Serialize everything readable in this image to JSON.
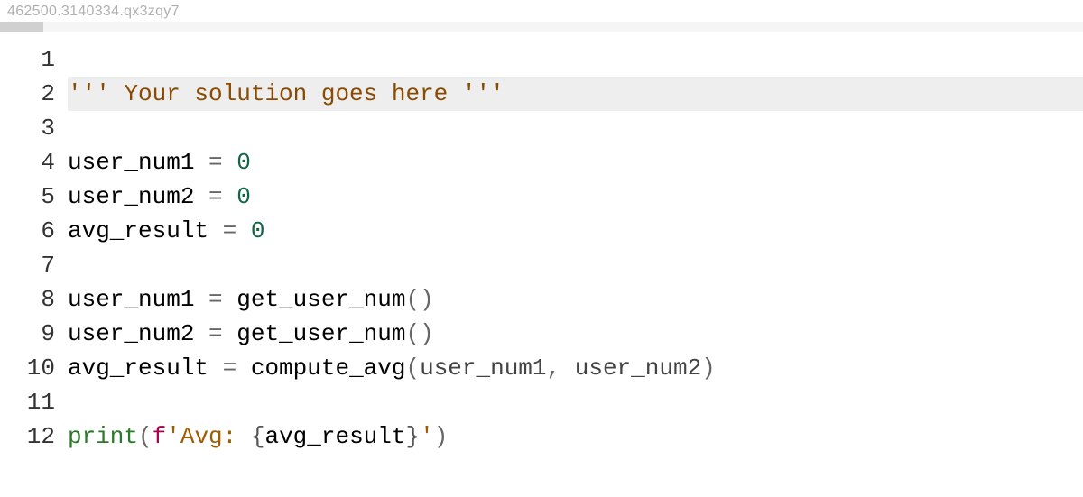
{
  "header_id": "462500.3140334.qx3zqy7",
  "lines": [
    {
      "num": "1",
      "highlighted": false,
      "tokens": []
    },
    {
      "num": "2",
      "highlighted": true,
      "tokens": [
        {
          "cls": "tok-comment",
          "text": "'''"
        },
        {
          "cls": "tok-string-brown",
          "text": " Your solution goes here "
        },
        {
          "cls": "tok-comment",
          "text": "'''"
        }
      ]
    },
    {
      "num": "3",
      "highlighted": false,
      "tokens": []
    },
    {
      "num": "4",
      "highlighted": false,
      "tokens": [
        {
          "cls": "tok-default",
          "text": "user_num1 "
        },
        {
          "cls": "tok-operator",
          "text": "="
        },
        {
          "cls": "tok-default",
          "text": " "
        },
        {
          "cls": "tok-number",
          "text": "0"
        }
      ]
    },
    {
      "num": "5",
      "highlighted": false,
      "tokens": [
        {
          "cls": "tok-default",
          "text": "user_num2 "
        },
        {
          "cls": "tok-operator",
          "text": "="
        },
        {
          "cls": "tok-default",
          "text": " "
        },
        {
          "cls": "tok-number",
          "text": "0"
        }
      ]
    },
    {
      "num": "6",
      "highlighted": false,
      "tokens": [
        {
          "cls": "tok-default",
          "text": "avg_result "
        },
        {
          "cls": "tok-operator",
          "text": "="
        },
        {
          "cls": "tok-default",
          "text": " "
        },
        {
          "cls": "tok-number",
          "text": "0"
        }
      ]
    },
    {
      "num": "7",
      "highlighted": false,
      "tokens": []
    },
    {
      "num": "8",
      "highlighted": false,
      "tokens": [
        {
          "cls": "tok-default",
          "text": "user_num1 "
        },
        {
          "cls": "tok-operator",
          "text": "="
        },
        {
          "cls": "tok-default",
          "text": " get_user_num"
        },
        {
          "cls": "tok-paren",
          "text": "()"
        }
      ]
    },
    {
      "num": "9",
      "highlighted": false,
      "tokens": [
        {
          "cls": "tok-default",
          "text": "user_num2 "
        },
        {
          "cls": "tok-operator",
          "text": "="
        },
        {
          "cls": "tok-default",
          "text": " get_user_num"
        },
        {
          "cls": "tok-paren",
          "text": "()"
        }
      ]
    },
    {
      "num": "10",
      "highlighted": false,
      "tokens": [
        {
          "cls": "tok-default",
          "text": "avg_result "
        },
        {
          "cls": "tok-operator",
          "text": "="
        },
        {
          "cls": "tok-default",
          "text": " compute_avg"
        },
        {
          "cls": "tok-paren",
          "text": "("
        },
        {
          "cls": "tok-arg",
          "text": "user_num1"
        },
        {
          "cls": "tok-paren",
          "text": ","
        },
        {
          "cls": "tok-arg",
          "text": " user_num2"
        },
        {
          "cls": "tok-paren",
          "text": ")"
        }
      ]
    },
    {
      "num": "11",
      "highlighted": false,
      "tokens": []
    },
    {
      "num": "12",
      "highlighted": false,
      "tokens": [
        {
          "cls": "tok-builtin",
          "text": "print"
        },
        {
          "cls": "tok-paren",
          "text": "("
        },
        {
          "cls": "tok-fstring-prefix",
          "text": "f"
        },
        {
          "cls": "tok-string",
          "text": "'Avg: "
        },
        {
          "cls": "tok-brace",
          "text": "{"
        },
        {
          "cls": "tok-default",
          "text": "avg_result"
        },
        {
          "cls": "tok-brace",
          "text": "}"
        },
        {
          "cls": "tok-string",
          "text": "'"
        },
        {
          "cls": "tok-paren",
          "text": ")"
        }
      ]
    }
  ]
}
